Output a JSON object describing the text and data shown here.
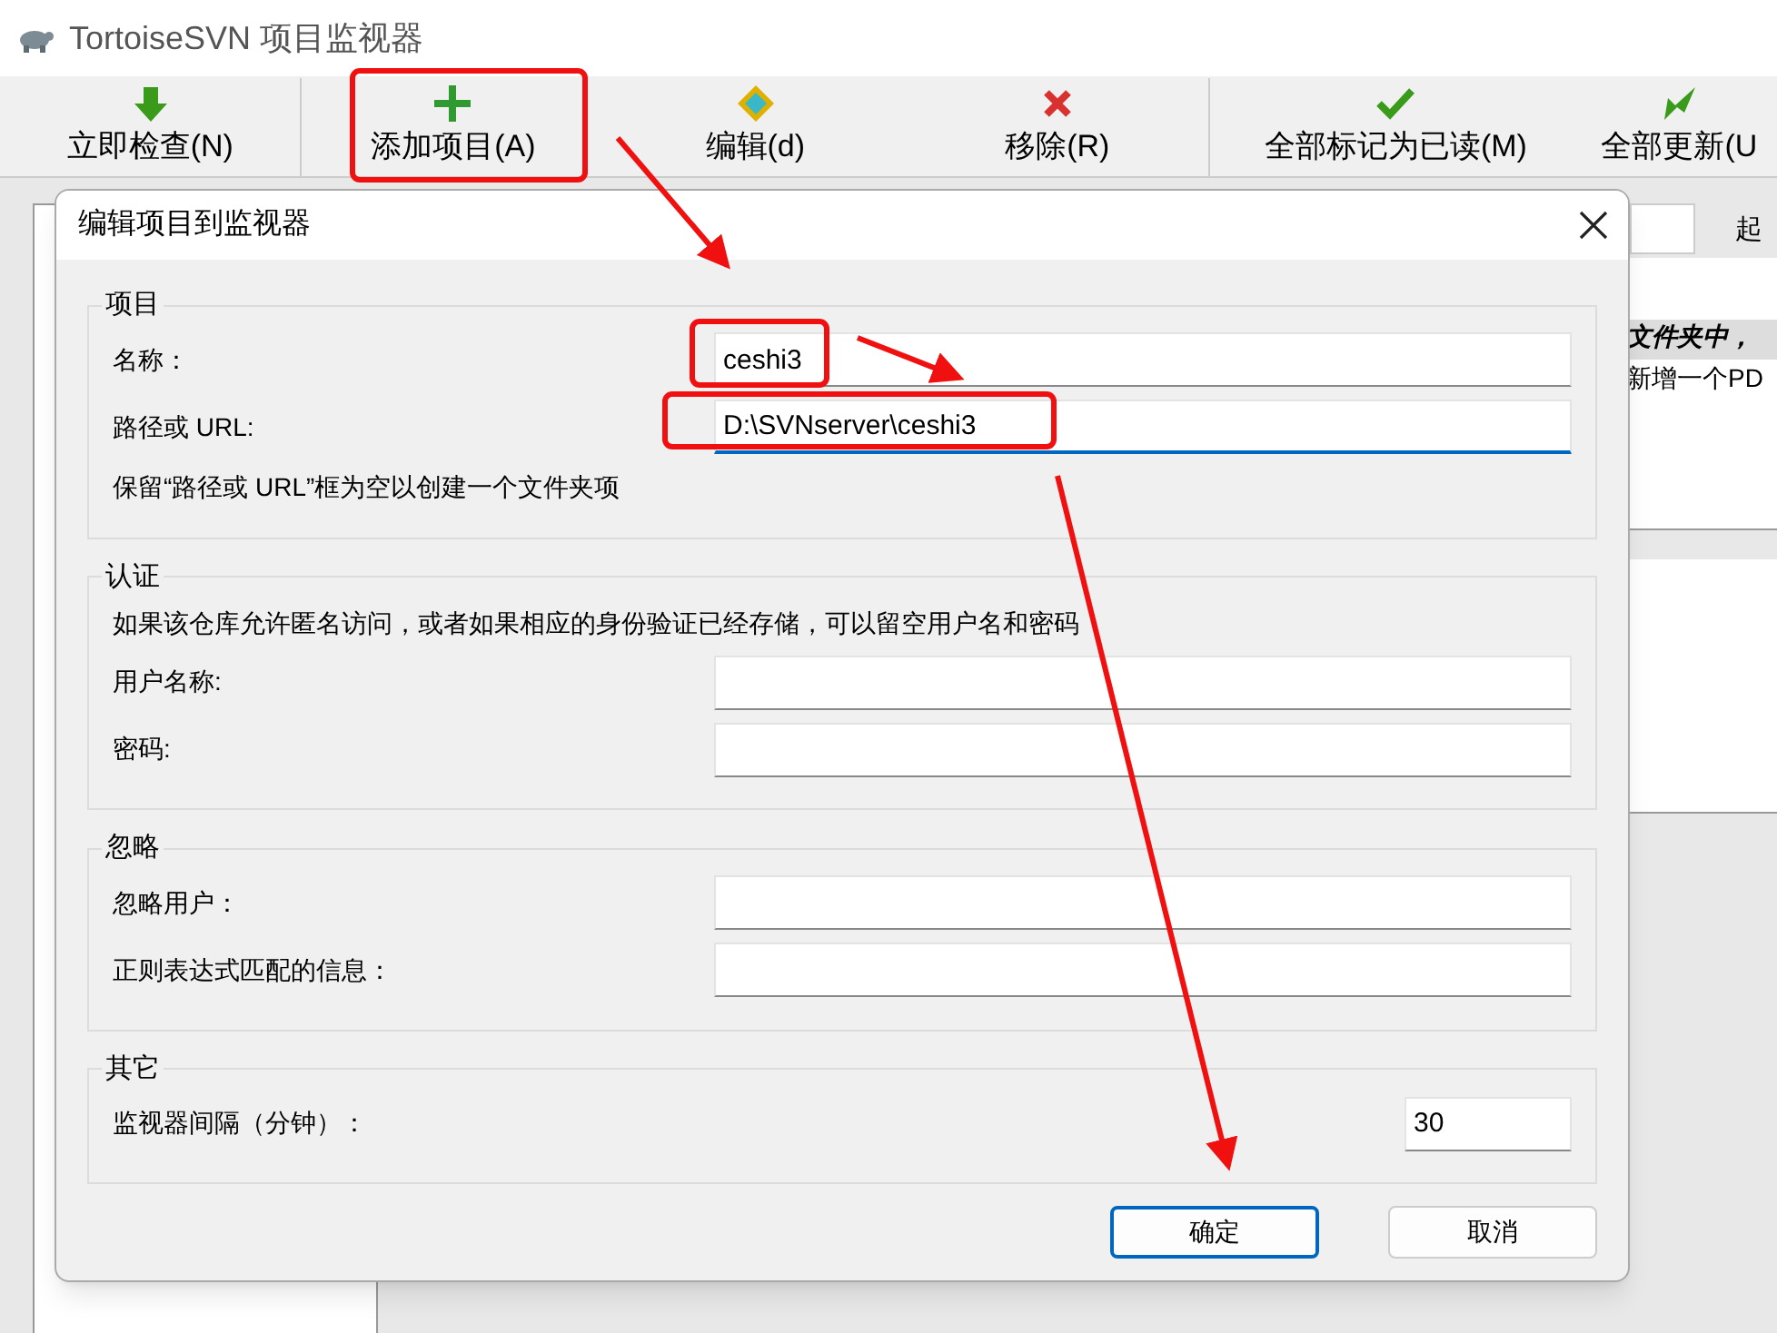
{
  "window": {
    "title": "TortoiseSVN 项目监视器"
  },
  "toolbar": [
    {
      "kind": "down",
      "label": "立即检查(N)"
    },
    {
      "kind": "plus",
      "label": "添加项目(A)"
    },
    {
      "kind": "diamond",
      "label": "编辑(d)"
    },
    {
      "kind": "cross",
      "label": "移除(R)"
    },
    {
      "kind": "tick",
      "label": "全部标记为已读(M)"
    },
    {
      "kind": "leaf",
      "label": "全部更新(U"
    }
  ],
  "background": {
    "column_header": "起",
    "rows": [
      {
        "kind": "emphasis",
        "text": "文件夹中，"
      },
      {
        "kind": "plain",
        "text": "新增一个PD"
      }
    ]
  },
  "dialog": {
    "title": "编辑项目到监视器",
    "groups": [
      {
        "title": "项目",
        "rows": [
          {
            "kind": "field",
            "label": "名称：",
            "value": "ceshi3",
            "focused": false
          },
          {
            "kind": "field",
            "label": "路径或 URL:",
            "value": "D:\\SVNserver\\ceshi3",
            "focused": true
          },
          {
            "kind": "note",
            "text": "保留“路径或 URL”框为空以创建一个文件夹项"
          }
        ]
      },
      {
        "title": "认证",
        "rows": [
          {
            "kind": "note",
            "text": "如果该仓库允许匿名访问，或者如果相应的身份验证已经存储，可以留空用户名和密码"
          },
          {
            "kind": "field",
            "label": "用户名称:",
            "value": "",
            "focused": false
          },
          {
            "kind": "field",
            "label": "密码:",
            "value": "",
            "focused": false
          }
        ]
      },
      {
        "title": "忽略",
        "rows": [
          {
            "kind": "field",
            "label": "忽略用户：",
            "value": "",
            "focused": false
          },
          {
            "kind": "field",
            "label": "正则表达式匹配的信息：",
            "value": "",
            "focused": false
          }
        ]
      },
      {
        "title": "其它",
        "rows": [
          {
            "kind": "number",
            "label": "监视器间隔（分钟）：",
            "value": "30",
            "focused": false
          }
        ]
      }
    ],
    "buttons": [
      {
        "label": "确定",
        "default": true
      },
      {
        "label": "取消",
        "default": false
      }
    ]
  }
}
